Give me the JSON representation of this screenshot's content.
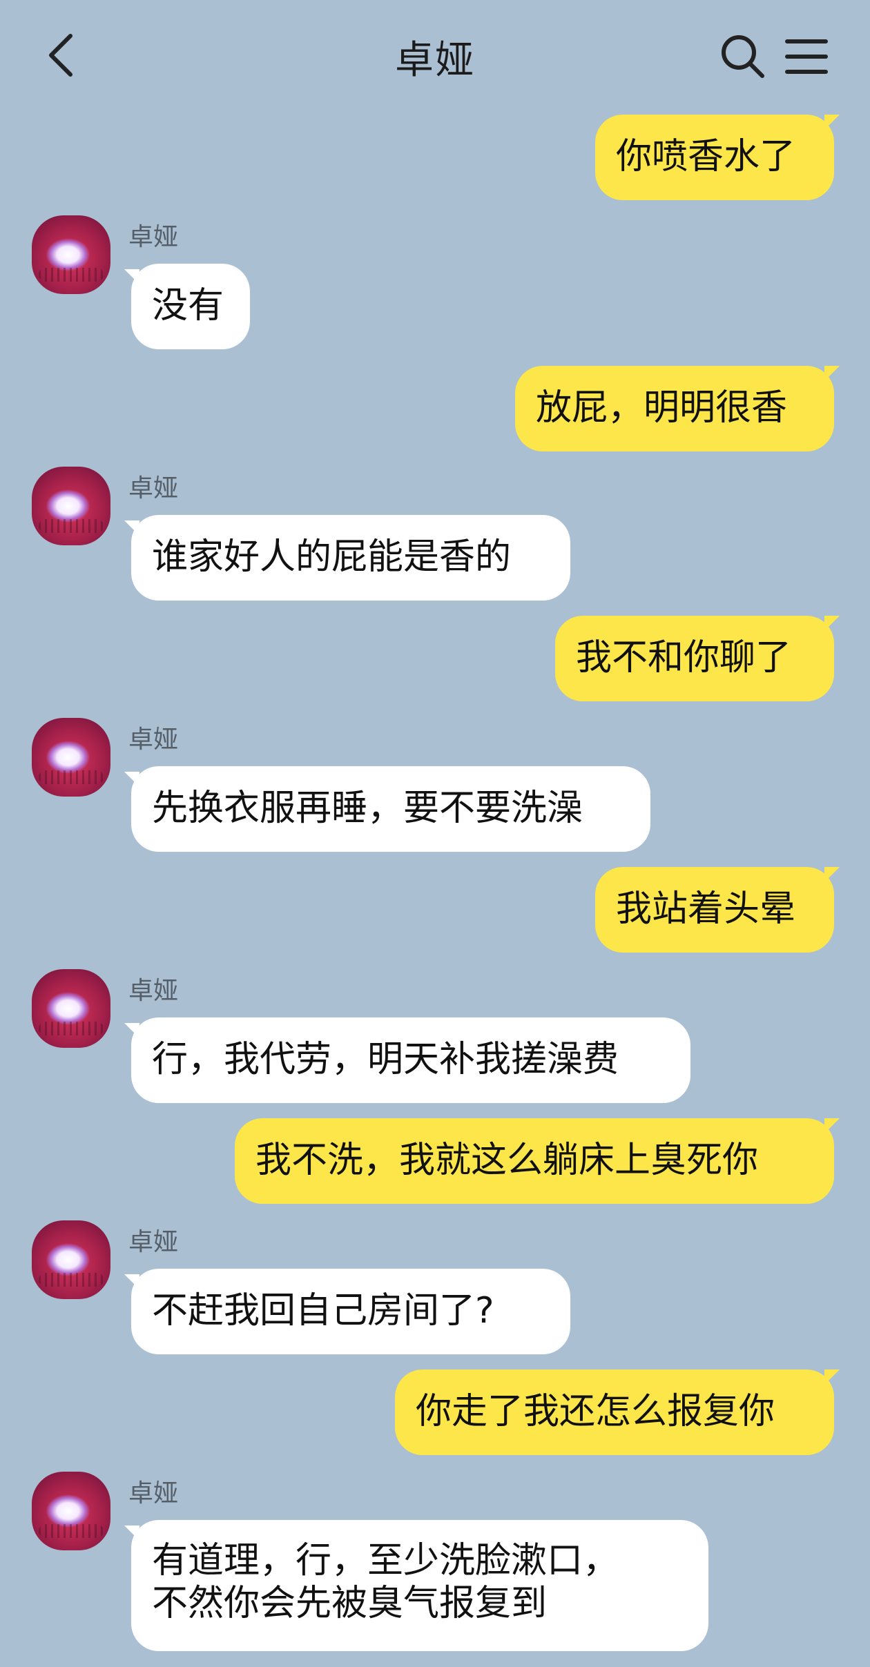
{
  "header": {
    "title": "卓娅",
    "back_icon": "chevron-left-icon",
    "search_icon": "search-icon",
    "menu_icon": "menu-icon"
  },
  "colors": {
    "background": "#aabfd2",
    "my_bubble": "#fde64a",
    "other_bubble": "#ffffff"
  },
  "messages": [
    {
      "from": "me",
      "text": "你喷香水了"
    },
    {
      "from": "other",
      "sender": "卓娅",
      "text": "没有"
    },
    {
      "from": "me",
      "text": "放屁，明明很香"
    },
    {
      "from": "other",
      "sender": "卓娅",
      "text": "谁家好人的屁能是香的"
    },
    {
      "from": "me",
      "text": "我不和你聊了"
    },
    {
      "from": "other",
      "sender": "卓娅",
      "text": "先换衣服再睡，要不要洗澡"
    },
    {
      "from": "me",
      "text": "我站着头晕"
    },
    {
      "from": "other",
      "sender": "卓娅",
      "text": "行，我代劳，明天补我搓澡费"
    },
    {
      "from": "me",
      "text": "我不洗，我就这么躺床上臭死你"
    },
    {
      "from": "other",
      "sender": "卓娅",
      "text": "不赶我回自己房间了?"
    },
    {
      "from": "me",
      "text": "你走了我还怎么报复你"
    },
    {
      "from": "other",
      "sender": "卓娅",
      "lines": [
        "有道理，行，至少洗脸漱口，",
        "不然你会先被臭气报复到"
      ]
    }
  ]
}
